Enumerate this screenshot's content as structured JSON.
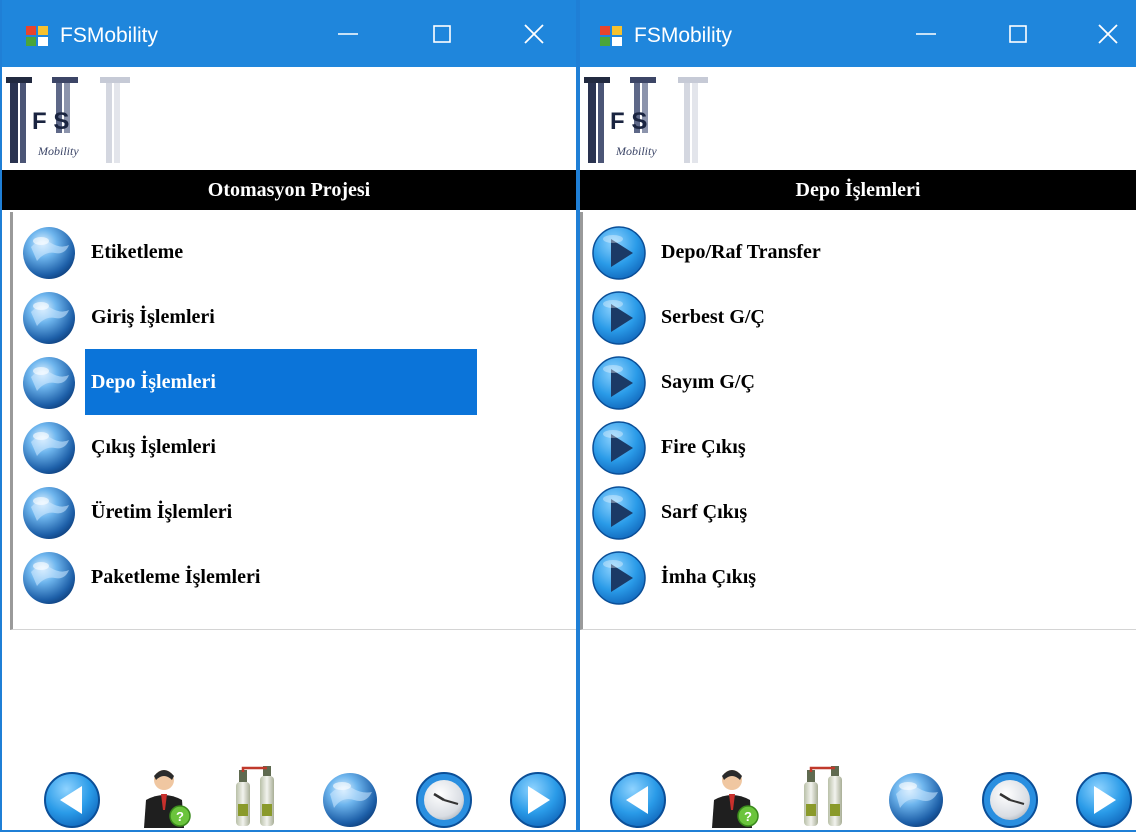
{
  "colors": {
    "titlebar": "#1f86dc",
    "selection": "#0b74d9",
    "header": "#000000"
  },
  "logo": {
    "letters": "F S",
    "subtitle": "Mobility"
  },
  "windows": [
    {
      "title": "FSMobility",
      "header": "Otomasyon Projesi",
      "item_icon": "globe-icon",
      "items": [
        {
          "label": "Etiketleme",
          "selected": false
        },
        {
          "label": "Giriş İşlemleri",
          "selected": false
        },
        {
          "label": "Depo İşlemleri",
          "selected": true
        },
        {
          "label": "Çıkış İşlemleri",
          "selected": false
        },
        {
          "label": "Üretim İşlemleri",
          "selected": false
        },
        {
          "label": "Paketleme İşlemleri",
          "selected": false
        }
      ]
    },
    {
      "title": "FSMobility",
      "header": "Depo İşlemleri",
      "item_icon": "play-icon",
      "items": [
        {
          "label": "Depo/Raf Transfer",
          "selected": false
        },
        {
          "label": "Serbest G/Ç",
          "selected": false
        },
        {
          "label": "Sayım G/Ç",
          "selected": false
        },
        {
          "label": "Fire Çıkış",
          "selected": false
        },
        {
          "label": "Sarf Çıkış",
          "selected": false
        },
        {
          "label": "İmha Çıkış",
          "selected": false
        }
      ]
    }
  ],
  "bottom_bar": [
    "back-arrow-icon",
    "user-help-icon",
    "gas-cylinders-icon",
    "globe-icon",
    "clock-icon",
    "forward-arrow-icon"
  ]
}
